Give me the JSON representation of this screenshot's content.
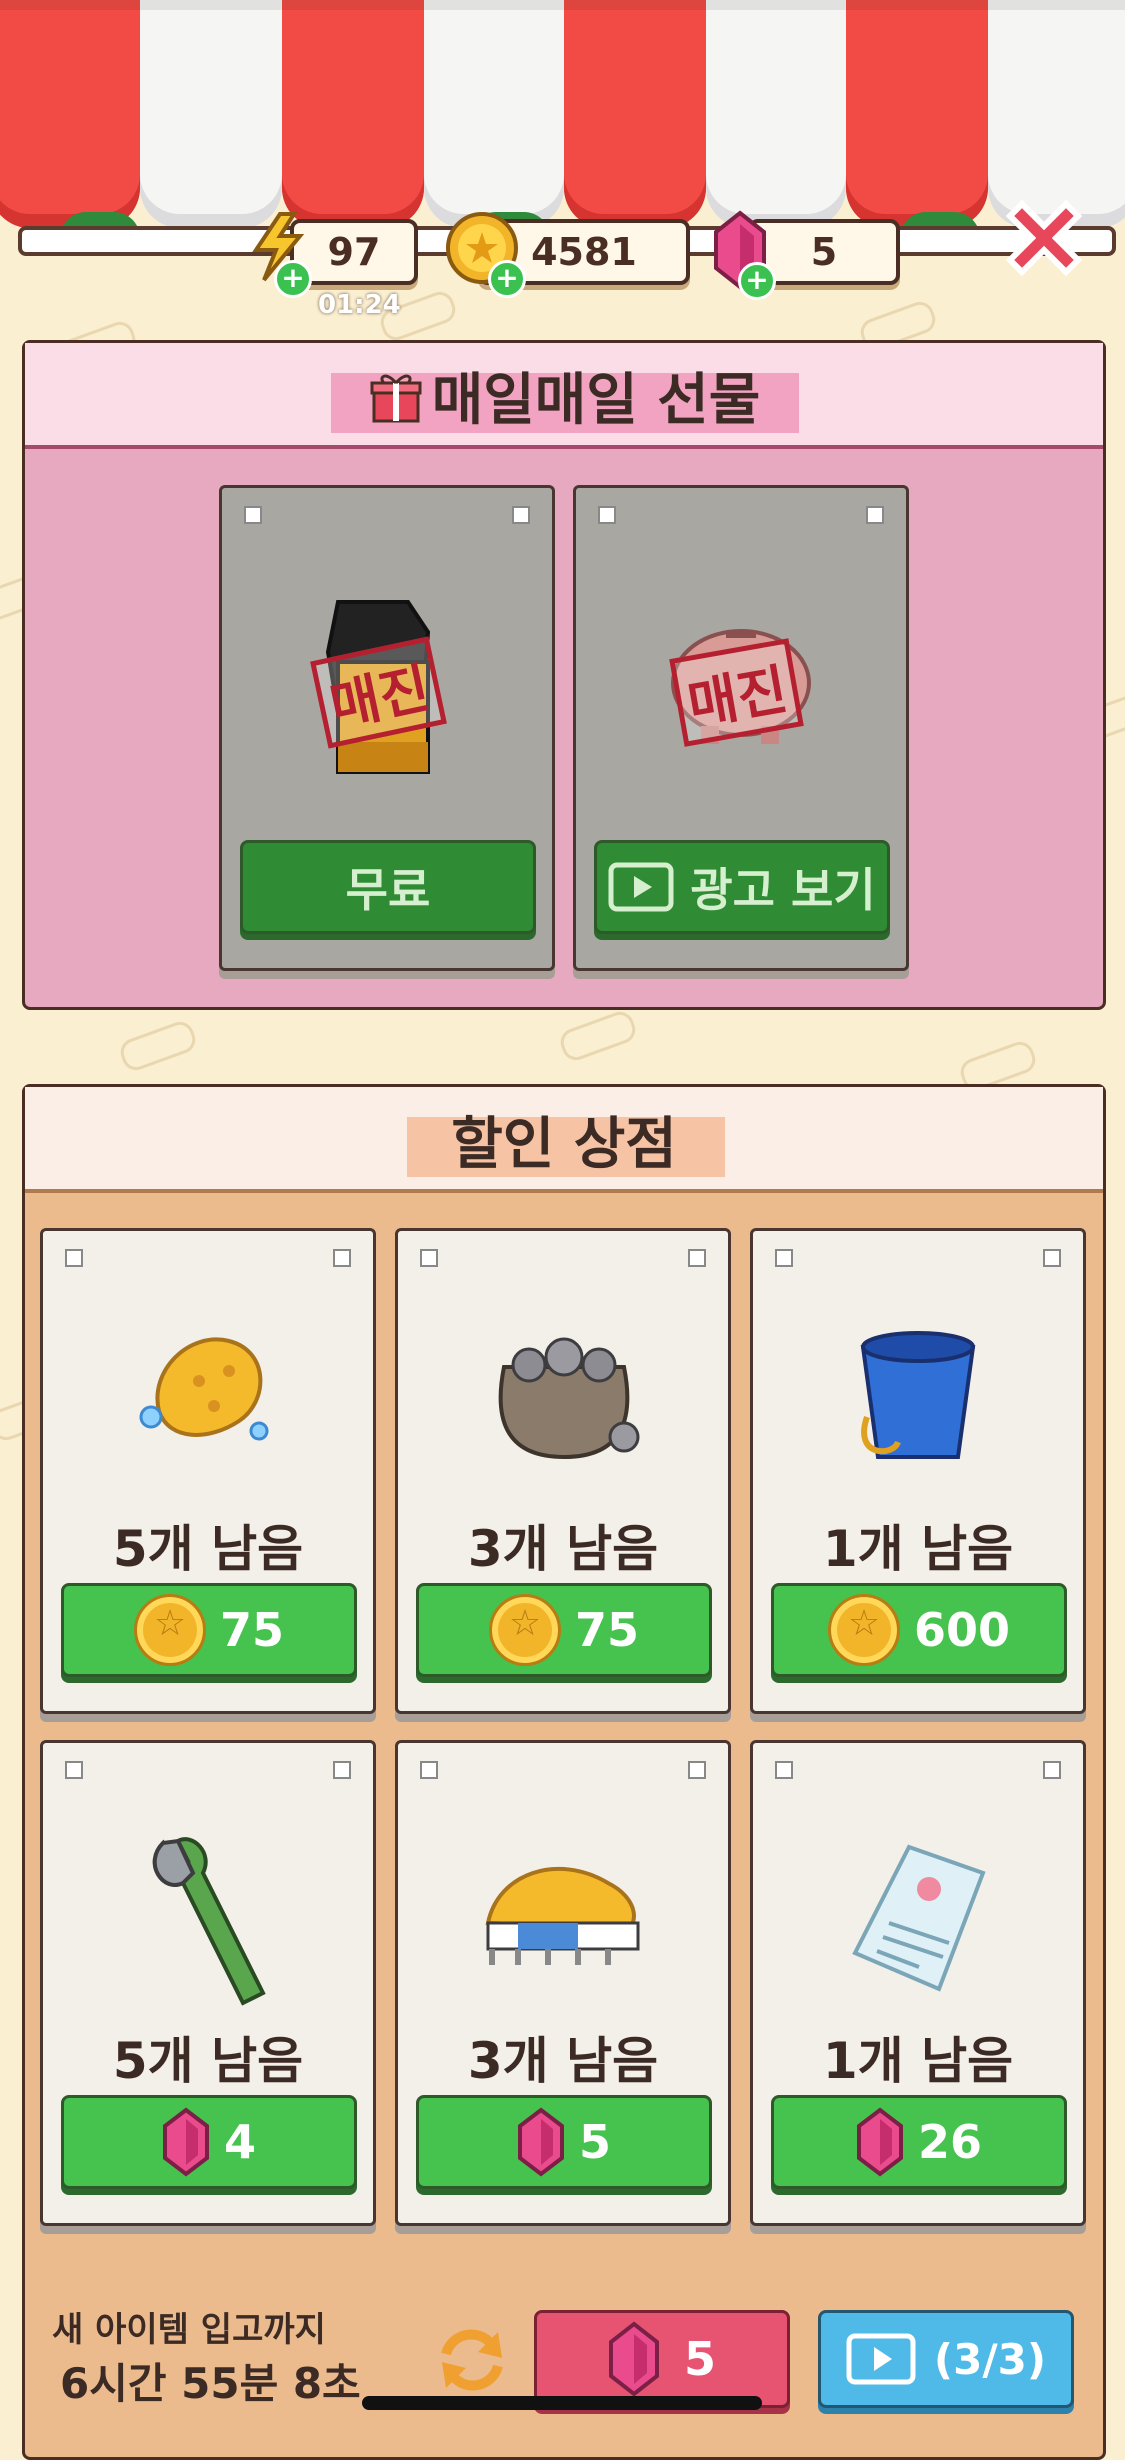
{
  "header": {
    "energy": {
      "value": "97",
      "timer": "01:24",
      "icon": "lightning-icon"
    },
    "coins": {
      "value": "4581",
      "icon": "coin-icon"
    },
    "gems": {
      "value": "5",
      "icon": "gem-icon"
    },
    "close_icon": "close-icon"
  },
  "daily_gift": {
    "title": "매일매일 선물",
    "icon": "gift-icon",
    "items": [
      {
        "name": "oil-bottle",
        "stamp": "매진",
        "button_label": "무료"
      },
      {
        "name": "piggy-bank",
        "stamp": "매진",
        "button_label": "광고 보기",
        "button_icon": "play-ad-icon"
      }
    ]
  },
  "discount_shop": {
    "title": "할인 상점",
    "items": [
      {
        "item": "sponge-icon",
        "remaining": "5개 남음",
        "currency": "coin",
        "price": "75"
      },
      {
        "item": "stone-sack-icon",
        "remaining": "3개 남음",
        "currency": "coin",
        "price": "75"
      },
      {
        "item": "bucket-icon",
        "remaining": "1개 남음",
        "currency": "coin",
        "price": "600"
      },
      {
        "item": "wrench-icon",
        "remaining": "5개 남음",
        "currency": "gem",
        "price": "4"
      },
      {
        "item": "brush-icon",
        "remaining": "3개 남음",
        "currency": "gem",
        "price": "5"
      },
      {
        "item": "receipt-icon",
        "remaining": "1개 남음",
        "currency": "gem",
        "price": "26"
      }
    ],
    "restock_label": "새 아이템 입고까지",
    "restock_time": "6시간 55분 8초",
    "refresh_price": "5",
    "ad_refresh_count": "(3/3)"
  },
  "colors": {
    "background": "#fbefd2",
    "awning_red": "#f24b45",
    "gift_panel": "#e6a9c0",
    "shop_panel": "#ecbb8d",
    "button_green": "#46c24e",
    "refresh_pink": "#e75472",
    "ad_blue": "#4fb9e8"
  }
}
